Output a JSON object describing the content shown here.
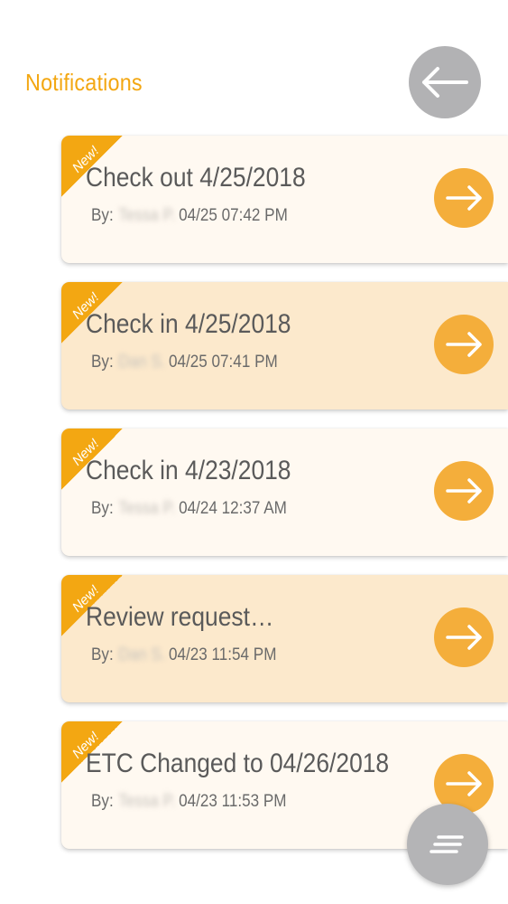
{
  "header": {
    "title": "Notifications",
    "back_icon": "arrow-left-icon"
  },
  "colors": {
    "accent": "#F3A712",
    "card_light": "#FFF9F1",
    "card_tan": "#FCE9CC",
    "button_gray": "#B2B2B4"
  },
  "notifications": [
    {
      "badge": "New!",
      "title": "Check out 4/25/2018",
      "by_label": "By:",
      "author": "Tessa P.",
      "timestamp": "04/25 07:42 PM",
      "style": "light"
    },
    {
      "badge": "New!",
      "title": "Check in 4/25/2018",
      "by_label": "By:",
      "author": "Dan S.",
      "timestamp": "04/25 07:41 PM",
      "style": "tan"
    },
    {
      "badge": "New!",
      "title": "Check in 4/23/2018",
      "by_label": "By:",
      "author": "Tessa P.",
      "timestamp": "04/24 12:37 AM",
      "style": "light"
    },
    {
      "badge": "New!",
      "title": "Review request…",
      "by_label": "By:",
      "author": "Dan S.",
      "timestamp": "04/23 11:54 PM",
      "style": "tan"
    },
    {
      "badge": "New!",
      "title": "ETC Changed to 04/26/2018",
      "by_label": "By:",
      "author": "Tessa P.",
      "timestamp": "04/23 11:53 PM",
      "style": "light"
    }
  ],
  "fab": {
    "icon": "menu-lines-icon"
  }
}
